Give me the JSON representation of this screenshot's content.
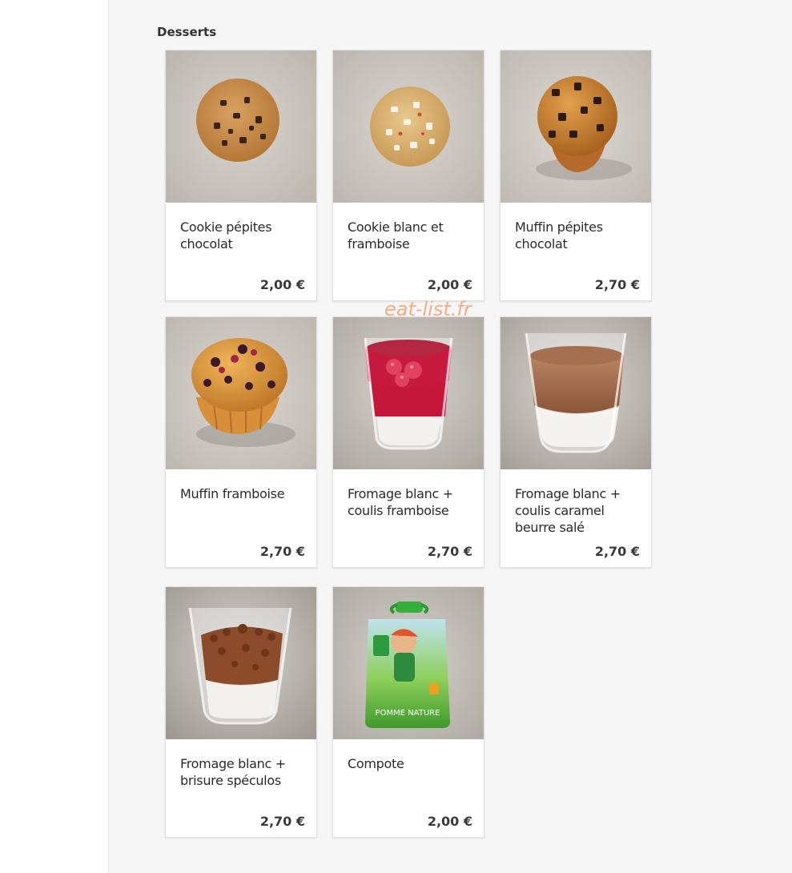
{
  "section": {
    "title": "Desserts"
  },
  "watermark": "eat-list.fr",
  "items": [
    {
      "name": "Cookie pépites chocolat",
      "price": "2,00 €",
      "image": "chocolate-chip-cookie"
    },
    {
      "name": "Cookie blanc et framboise",
      "price": "2,00 €",
      "image": "white-raspberry-cookie"
    },
    {
      "name": "Muffin pépites chocolat",
      "price": "2,70 €",
      "image": "chocolate-chip-muffin"
    },
    {
      "name": "Muffin framboise",
      "price": "2,70 €",
      "image": "raspberry-muffin"
    },
    {
      "name": "Fromage blanc + coulis framboise",
      "price": "2,70 €",
      "image": "fromage-blanc-raspberry-glass"
    },
    {
      "name": "Fromage blanc + coulis caramel beurre salé",
      "price": "2,70 €",
      "image": "fromage-blanc-caramel-glass"
    },
    {
      "name": "Fromage blanc + brisure spéculos",
      "price": "2,70 €",
      "image": "fromage-blanc-speculoos-glass"
    },
    {
      "name": "Compote",
      "price": "2,00 €",
      "image": "compote-pouch"
    }
  ]
}
